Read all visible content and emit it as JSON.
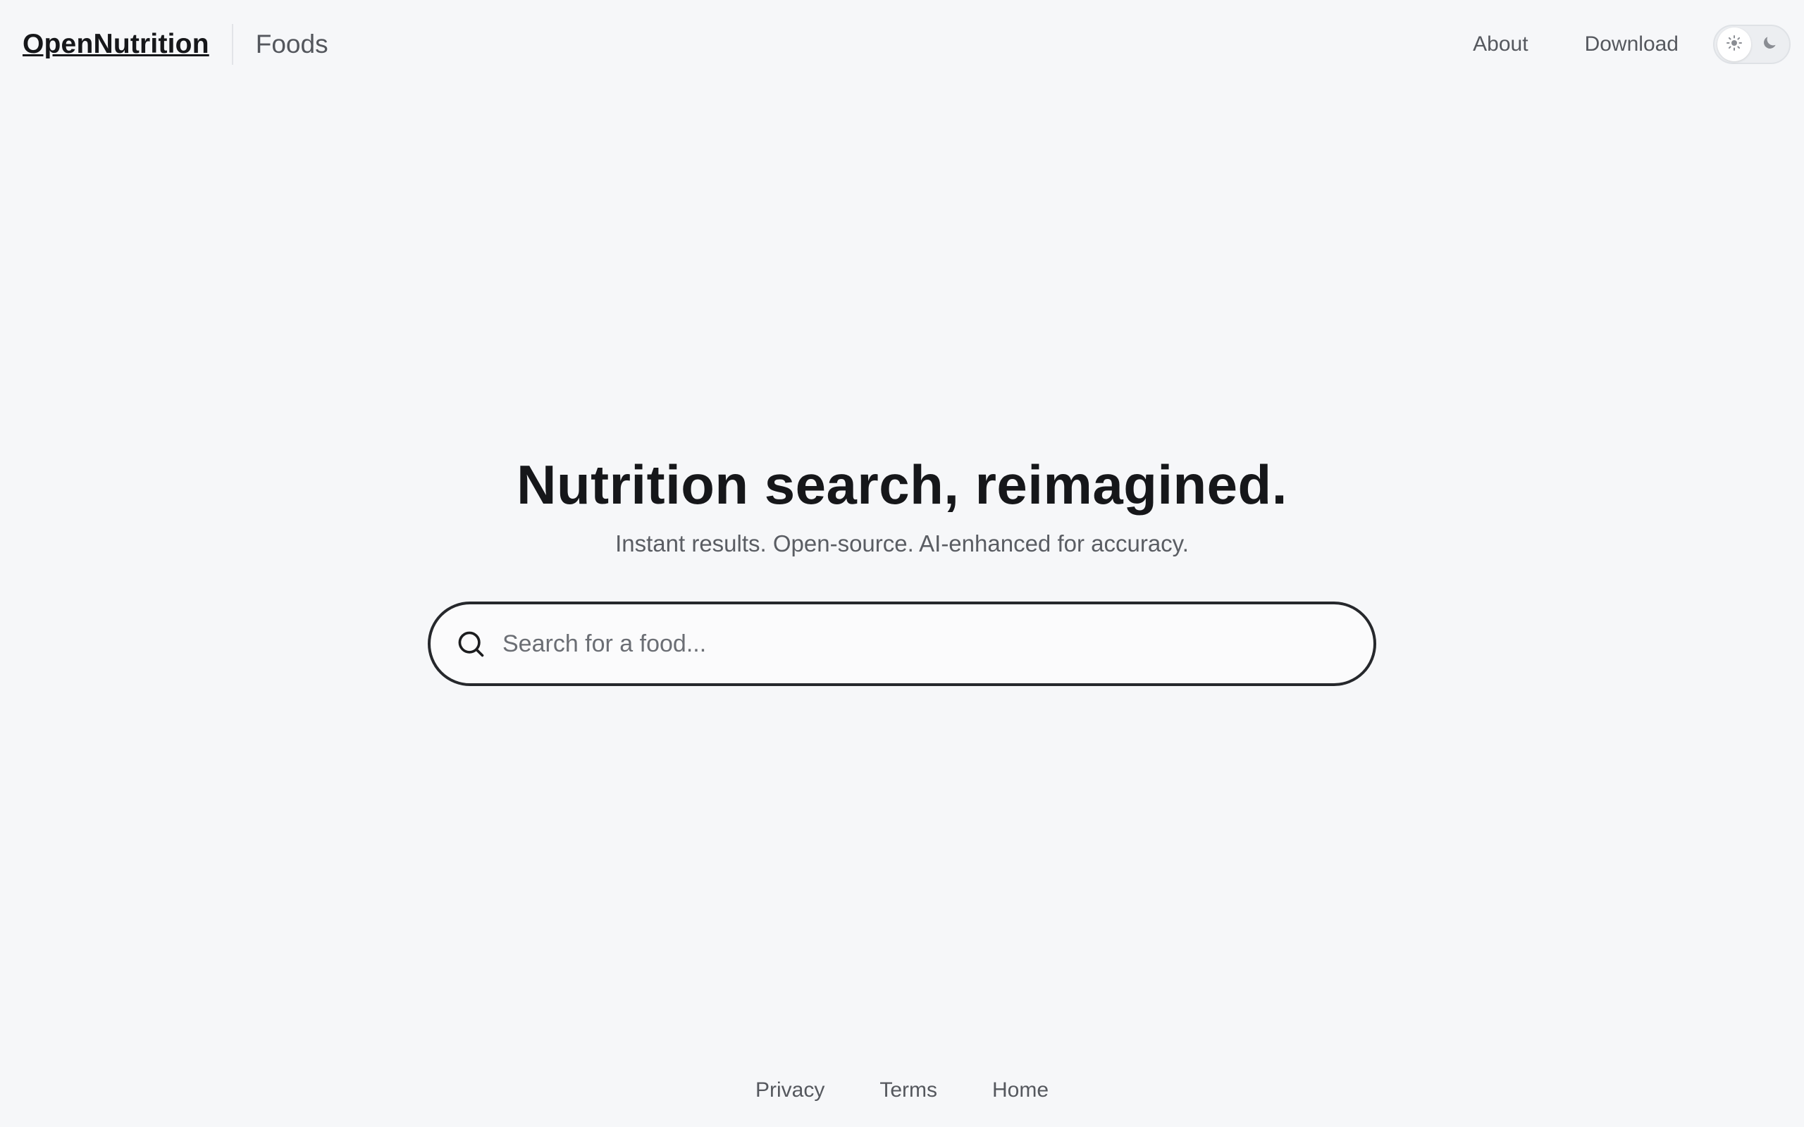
{
  "header": {
    "logo": "OpenNutrition",
    "section": "Foods",
    "nav": [
      {
        "label": "About"
      },
      {
        "label": "Download"
      }
    ],
    "theme_toggle": {
      "options": [
        "light",
        "dark"
      ],
      "selected": "light",
      "icons": {
        "light": "sun-icon",
        "dark": "moon-icon"
      }
    }
  },
  "hero": {
    "title": "Nutrition search, reimagined.",
    "subtitle": "Instant results. Open-source. AI-enhanced for accuracy."
  },
  "search": {
    "icon": "search-icon",
    "value": "",
    "placeholder": "Search for a food..."
  },
  "footer": {
    "links": [
      {
        "label": "Privacy"
      },
      {
        "label": "Terms"
      },
      {
        "label": "Home"
      }
    ]
  },
  "colors": {
    "background": "#f6f7f9",
    "text_primary": "#16171a",
    "text_secondary": "#55585e",
    "search_border": "#26282c"
  }
}
